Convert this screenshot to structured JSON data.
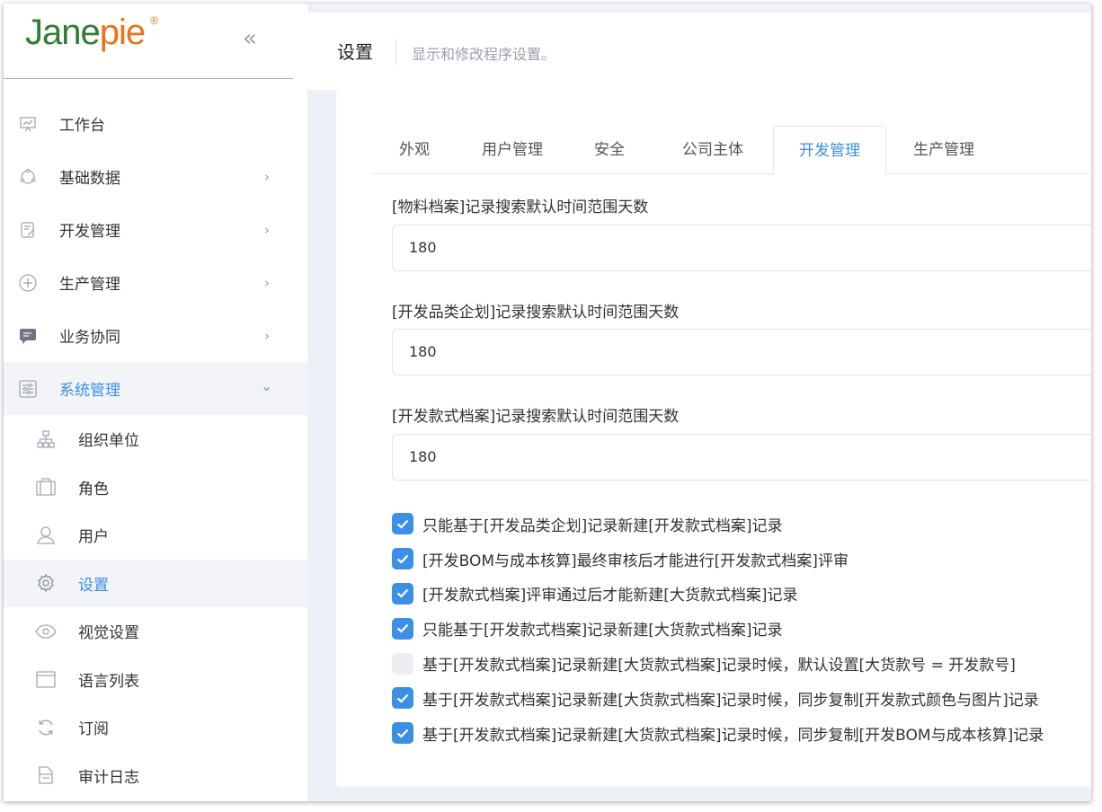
{
  "brand": {
    "name_part1": "Jane",
    "name_part2": "pie",
    "registered": "®"
  },
  "sidebar": {
    "collapse_glyph": "«",
    "items": [
      {
        "label": "工作台",
        "icon": "chart-board-icon",
        "has_arrow": false
      },
      {
        "label": "基础数据",
        "icon": "cycle-icon",
        "has_arrow": true
      },
      {
        "label": "开发管理",
        "icon": "edit-list-icon",
        "has_arrow": true
      },
      {
        "label": "生产管理",
        "icon": "plus-circle-icon",
        "has_arrow": true
      },
      {
        "label": "业务协同",
        "icon": "chat-icon",
        "has_arrow": true
      },
      {
        "label": "系统管理",
        "icon": "settings-panel-icon",
        "has_arrow": true,
        "active": true
      }
    ],
    "sub_items": [
      {
        "label": "组织单位",
        "icon": "org-tree-icon"
      },
      {
        "label": "角色",
        "icon": "briefcase-icon"
      },
      {
        "label": "用户",
        "icon": "user-icon"
      },
      {
        "label": "设置",
        "icon": "gear-icon",
        "active": true
      },
      {
        "label": "视觉设置",
        "icon": "eye-icon"
      },
      {
        "label": "语言列表",
        "icon": "window-icon"
      },
      {
        "label": "订阅",
        "icon": "refresh-icon"
      },
      {
        "label": "审计日志",
        "icon": "document-icon"
      }
    ]
  },
  "header": {
    "title": "设置",
    "description": "显示和修改程序设置。"
  },
  "tabs": [
    {
      "label": "外观"
    },
    {
      "label": "用户管理"
    },
    {
      "label": "安全"
    },
    {
      "label": "公司主体"
    },
    {
      "label": "开发管理",
      "active": true
    },
    {
      "label": "生产管理"
    }
  ],
  "fields": [
    {
      "label": "[物料档案]记录搜索默认时间范围天数",
      "value": "180"
    },
    {
      "label": "[开发品类企划]记录搜索默认时间范围天数",
      "value": "180"
    },
    {
      "label": "[开发款式档案]记录搜索默认时间范围天数",
      "value": "180"
    }
  ],
  "checkboxes": [
    {
      "label": "只能基于[开发品类企划]记录新建[开发款式档案]记录",
      "checked": true
    },
    {
      "label": "[开发BOM与成本核算]最终审核后才能进行[开发款式档案]评审",
      "checked": true
    },
    {
      "label": "[开发款式档案]评审通过后才能新建[大货款式档案]记录",
      "checked": true
    },
    {
      "label": "只能基于[开发款式档案]记录新建[大货款式档案]记录",
      "checked": true
    },
    {
      "label": "基于[开发款式档案]记录新建[大货款式档案]记录时候，默认设置[大货款号 = 开发款号]",
      "checked": false
    },
    {
      "label": "基于[开发款式档案]记录新建[大货款式档案]记录时候，同步复制[开发款式颜色与图片]记录",
      "checked": true
    },
    {
      "label": "基于[开发款式档案]记录新建[大货款式档案]记录时候，同步复制[开发BOM与成本核算]记录",
      "checked": true
    }
  ],
  "colors": {
    "accent": "#3b8fe6",
    "brand_green": "#2e7d32",
    "brand_orange": "#e8731a"
  }
}
